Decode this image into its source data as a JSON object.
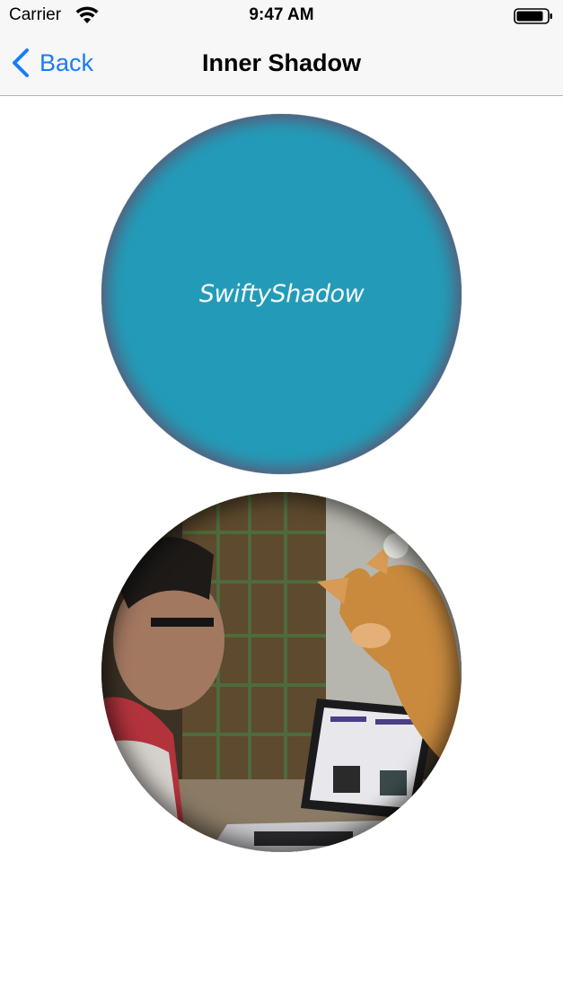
{
  "status_bar": {
    "carrier": "Carrier",
    "time": "9:47 AM",
    "icons": [
      "wifi-icon",
      "battery-icon"
    ]
  },
  "nav": {
    "back_label": "Back",
    "title": "Inner Shadow",
    "back_icon": "chevron-left-icon",
    "accent_color": "#1a7cf5"
  },
  "content": {
    "shadow_circle": {
      "label": "SwiftyShadow",
      "fill_color": "#239bb8",
      "shadow_color": "#5b5874"
    },
    "photo_circle": {
      "description_icon": "photo-image"
    }
  }
}
